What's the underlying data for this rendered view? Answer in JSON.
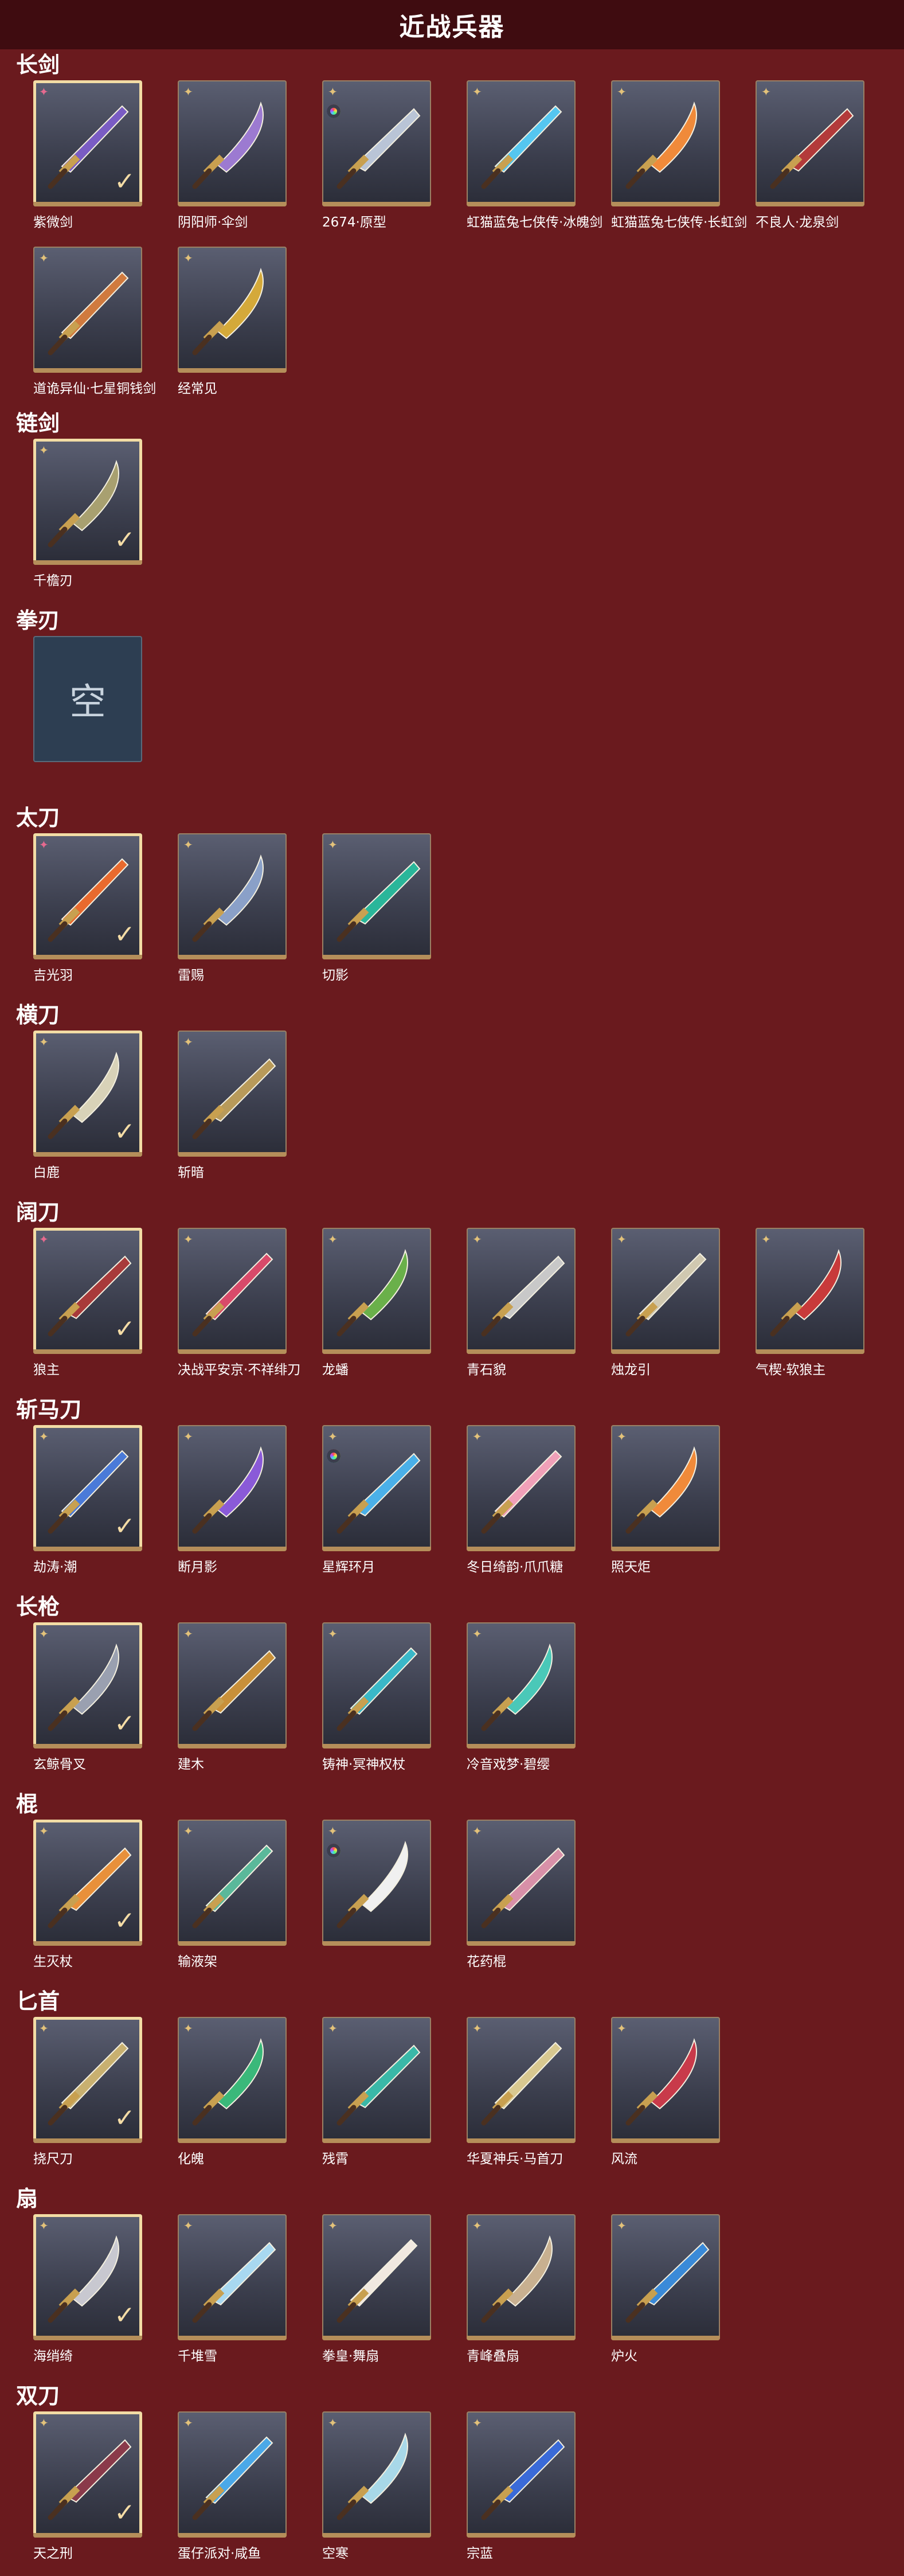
{
  "header": {
    "title": "近战兵器"
  },
  "sections": [
    {
      "title": "长剑",
      "items": [
        {
          "name": "紫微剑",
          "badge": "pink",
          "selected": true,
          "color": "#7a5cc4"
        },
        {
          "name": "阴阳师·伞剑",
          "badge": "gold",
          "selected": false,
          "color": "#9c7ad1"
        },
        {
          "name": "2674·原型",
          "badge": "rainbow",
          "selected": false,
          "color": "#b9c4d6"
        },
        {
          "name": "虹猫蓝兔七侠传·冰魄剑",
          "badge": "gold",
          "selected": false,
          "color": "#55c6f0"
        },
        {
          "name": "虹猫蓝兔七侠传·长虹剑",
          "badge": "gold",
          "selected": false,
          "color": "#f08a3a"
        },
        {
          "name": "不良人·龙泉剑",
          "badge": "gold",
          "selected": false,
          "color": "#b33a3a"
        },
        {
          "name": "道诡异仙·七星铜钱剑",
          "badge": "gold",
          "selected": false,
          "color": "#d07a3e"
        },
        {
          "name": "经常见",
          "badge": "gold",
          "selected": false,
          "color": "#d4a93a"
        }
      ]
    },
    {
      "title": "链剑",
      "items": [
        {
          "name": "千檐刃",
          "badge": "gold",
          "selected": true,
          "color": "#a8a070"
        }
      ]
    },
    {
      "title": "拳刃",
      "empty": "空",
      "items": []
    },
    {
      "title": "太刀",
      "items": [
        {
          "name": "吉光羽",
          "badge": "pink",
          "selected": true,
          "color": "#e86a2e"
        },
        {
          "name": "雷赐",
          "badge": "gold",
          "selected": false,
          "color": "#8aa0c8"
        },
        {
          "name": "切影",
          "badge": "gold",
          "selected": false,
          "color": "#2ab69a"
        }
      ]
    },
    {
      "title": "横刀",
      "items": [
        {
          "name": "白鹿",
          "badge": "gold",
          "selected": true,
          "color": "#d8d2b8"
        },
        {
          "name": "斩暗",
          "badge": "gold",
          "selected": false,
          "color": "#b89a5a"
        }
      ]
    },
    {
      "title": "阔刀",
      "items": [
        {
          "name": "狼主",
          "badge": "pink",
          "selected": true,
          "color": "#a83a3a"
        },
        {
          "name": "决战平安京·不祥绯刀",
          "badge": "gold",
          "selected": false,
          "color": "#d84a6a"
        },
        {
          "name": "龙蟠",
          "badge": "gold",
          "selected": false,
          "color": "#6ab04a"
        },
        {
          "name": "青石貌",
          "badge": "gold",
          "selected": false,
          "color": "#c8c8c8"
        },
        {
          "name": "烛龙引",
          "badge": "gold",
          "selected": false,
          "color": "#d0c8b0"
        },
        {
          "name": "气楔·软狼主",
          "badge": "gold",
          "selected": false,
          "color": "#c83a3a"
        }
      ]
    },
    {
      "title": "斩马刀",
      "items": [
        {
          "name": "劫涛·潮",
          "badge": "gold",
          "selected": true,
          "color": "#4a7ad8"
        },
        {
          "name": "断月影",
          "badge": "gold",
          "selected": false,
          "color": "#8a5ad8"
        },
        {
          "name": "星辉环月",
          "badge": "rainbow",
          "selected": false,
          "color": "#4ab0e8"
        },
        {
          "name": "冬日绮韵·爪爪糖",
          "badge": "gold",
          "selected": false,
          "color": "#f0a0b8"
        },
        {
          "name": "照天炬",
          "badge": "gold",
          "selected": false,
          "color": "#f08a3a"
        }
      ]
    },
    {
      "title": "长枪",
      "items": [
        {
          "name": "玄鲸骨叉",
          "badge": "gold",
          "selected": true,
          "color": "#9aa0b0"
        },
        {
          "name": "建木",
          "badge": "gold",
          "selected": false,
          "color": "#c8903a"
        },
        {
          "name": "铸神·冥神权杖",
          "badge": "gold",
          "selected": false,
          "color": "#3ab8c8"
        },
        {
          "name": "冷音戏梦·碧缨",
          "badge": "gold",
          "selected": false,
          "color": "#4ac8b8"
        }
      ]
    },
    {
      "title": "棍",
      "items": [
        {
          "name": "生灭杖",
          "badge": "gold",
          "selected": true,
          "color": "#e8903a"
        },
        {
          "name": "输液架",
          "badge": "gold",
          "selected": false,
          "color": "#5ab89a"
        },
        {
          "name": "",
          "badge": "rainbow",
          "selected": false,
          "color": "#f0f0f0"
        },
        {
          "name": "花药棍",
          "badge": "gold",
          "selected": false,
          "color": "#d890a8"
        }
      ]
    },
    {
      "title": "匕首",
      "items": [
        {
          "name": "挠尺刀",
          "badge": "gold",
          "selected": true,
          "color": "#c8b070"
        },
        {
          "name": "化魄",
          "badge": "gold",
          "selected": false,
          "color": "#3ab87a"
        },
        {
          "name": "残霄",
          "badge": "gold",
          "selected": false,
          "color": "#3ab8a8"
        },
        {
          "name": "华夏神兵·马首刀",
          "badge": "gold",
          "selected": false,
          "color": "#d8c890"
        },
        {
          "name": "风流",
          "badge": "gold",
          "selected": false,
          "color": "#c83a4a"
        }
      ]
    },
    {
      "title": "扇",
      "items": [
        {
          "name": "海绡绮",
          "badge": "gold",
          "selected": true,
          "color": "#c8c8d0"
        },
        {
          "name": "千堆雪",
          "badge": "gold",
          "selected": false,
          "color": "#a8d8f0"
        },
        {
          "name": "拳皇·舞扇",
          "badge": "gold",
          "selected": false,
          "color": "#f0e8e0"
        },
        {
          "name": "青峰叠扇",
          "badge": "gold",
          "selected": false,
          "color": "#c8b090"
        },
        {
          "name": "炉火",
          "badge": "gold",
          "selected": false,
          "color": "#3a8ad8"
        }
      ]
    },
    {
      "title": "双刀",
      "items": [
        {
          "name": "天之刑",
          "badge": "gold",
          "selected": true,
          "color": "#8a3a4a"
        },
        {
          "name": "蛋仔派对·咸鱼",
          "badge": "gold",
          "selected": false,
          "color": "#4aa8e8"
        },
        {
          "name": "空寒",
          "badge": "gold",
          "selected": false,
          "color": "#a8d8e8"
        },
        {
          "name": "宗蓝",
          "badge": "gold",
          "selected": false,
          "color": "#3a6ad8"
        }
      ]
    }
  ]
}
